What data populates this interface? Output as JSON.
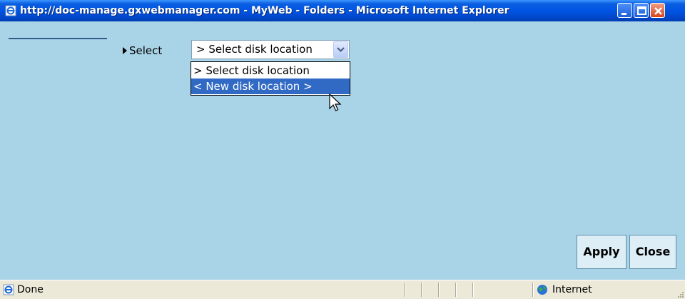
{
  "window": {
    "title": "http://doc-manage.gxwebmanager.com - MyWeb - Folders - Microsoft Internet Explorer",
    "controls": [
      "minimize-icon",
      "maximize-icon",
      "close-icon"
    ]
  },
  "form": {
    "select_label": "Select",
    "select": {
      "current_value": "> Select disk location",
      "options": [
        "> Select disk location",
        "< New disk location >"
      ],
      "highlighted_option": "< New disk location >"
    }
  },
  "buttons": {
    "apply_label": "Apply",
    "close_label": "Close"
  },
  "statusbar": {
    "status_text": "Done",
    "zone_text": "Internet"
  },
  "colors": {
    "content_bg": "#a9d3e7",
    "titlebar": "#0054e3",
    "highlight": "#316ac5"
  }
}
